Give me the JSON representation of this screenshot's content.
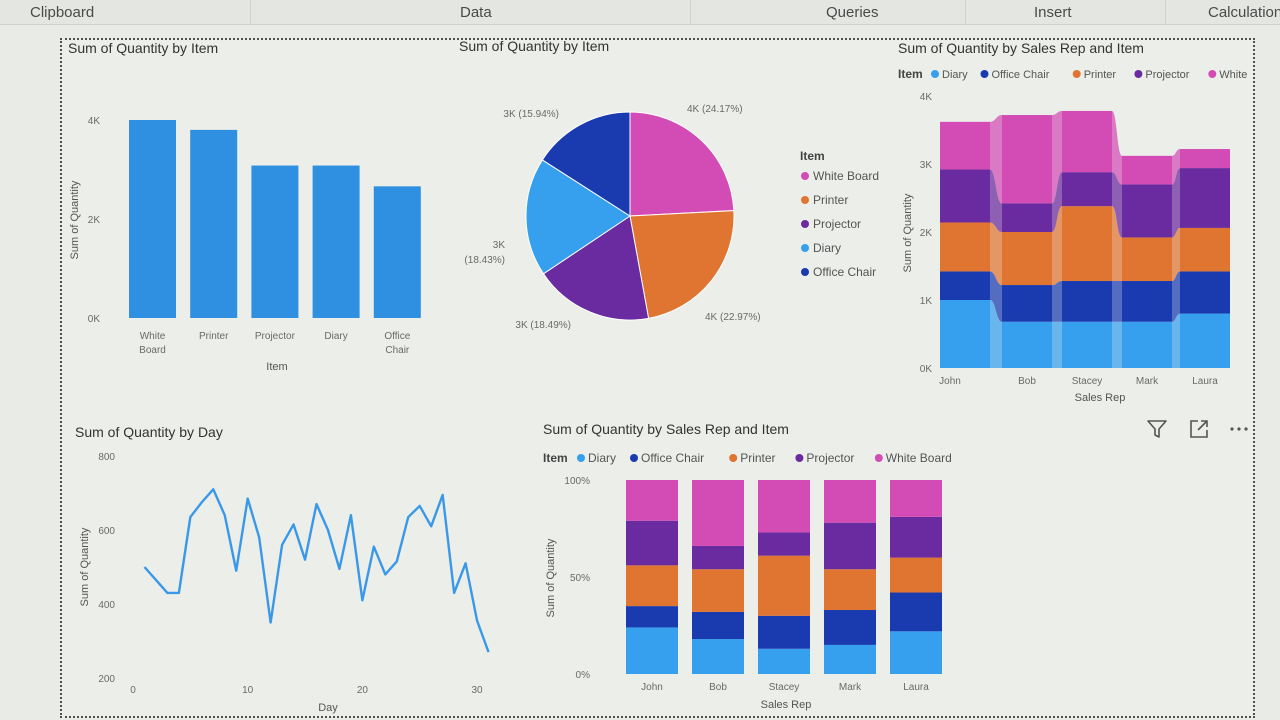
{
  "ribbon": {
    "items": [
      "Clipboard",
      "Data",
      "Queries",
      "Insert",
      "Calculation"
    ]
  },
  "colors": {
    "bar_blue": "#2f8fe0",
    "white_board": "#d34cb5",
    "printer": "#e07532",
    "projector": "#6a2aa0",
    "diary": "#36a0ee",
    "office_chair": "#1a3bb0",
    "line": "#3a98e8"
  },
  "visual_icons": [
    "filter-icon",
    "focus-mode-icon",
    "more-options-icon"
  ],
  "chart_data": [
    {
      "id": "bar",
      "type": "bar",
      "title": "Sum of Quantity by Item",
      "xlabel": "Item",
      "ylabel": "Sum of Quantity",
      "categories": [
        "White Board",
        "Printer",
        "Projector",
        "Diary",
        "Office Chair"
      ],
      "category_lines": [
        [
          "White",
          "Board"
        ],
        [
          "Printer"
        ],
        [
          "Projector"
        ],
        [
          "Diary"
        ],
        [
          "Office",
          "Chair"
        ]
      ],
      "values": [
        4000,
        3800,
        3080,
        3080,
        2660
      ],
      "ylim": [
        0,
        4000
      ],
      "yticks": [
        0,
        2000,
        4000
      ],
      "ytick_labels": [
        "0K",
        "2K",
        "4K"
      ]
    },
    {
      "id": "pie",
      "type": "pie",
      "title": "Sum of Quantity by Item",
      "legend_title": "Item",
      "labels": [
        "White Board",
        "Printer",
        "Projector",
        "Diary",
        "Office Chair"
      ],
      "values": [
        24.17,
        22.97,
        18.49,
        18.43,
        15.94
      ],
      "data_labels": [
        "4K (24.17%)",
        "4K (22.97%)",
        "3K (18.49%)",
        "3K (18.43%)",
        "3K (15.94%)"
      ]
    },
    {
      "id": "ribbon",
      "type": "area",
      "title": "Sum of Quantity by Sales Rep and Item",
      "xlabel": "Sales Rep",
      "ylabel": "Sum of Quantity",
      "legend_title": "Item",
      "legend": [
        "Diary",
        "Office Chair",
        "Printer",
        "Projector",
        "White Bo..."
      ],
      "categories": [
        "John",
        "Bob",
        "Stacey",
        "Mark",
        "Laura"
      ],
      "ylim": [
        0,
        4000
      ],
      "yticks": [
        0,
        1000,
        2000,
        3000,
        4000
      ],
      "ytick_labels": [
        "0K",
        "1K",
        "2K",
        "3K",
        "4K"
      ],
      "series": [
        {
          "name": "Diary",
          "values": [
            1000,
            680,
            680,
            680,
            800
          ]
        },
        {
          "name": "Office Chair",
          "values": [
            420,
            540,
            600,
            600,
            620
          ]
        },
        {
          "name": "Printer",
          "values": [
            720,
            780,
            1100,
            640,
            640
          ]
        },
        {
          "name": "Projector",
          "values": [
            780,
            420,
            500,
            780,
            880
          ]
        },
        {
          "name": "White Board",
          "values": [
            700,
            1300,
            900,
            420,
            280
          ]
        }
      ]
    },
    {
      "id": "line",
      "type": "line",
      "title": "Sum of Quantity by Day",
      "xlabel": "Day",
      "ylabel": "Sum of Quantity",
      "x": [
        1,
        2,
        3,
        4,
        5,
        6,
        7,
        8,
        9,
        10,
        11,
        12,
        13,
        14,
        15,
        16,
        17,
        18,
        19,
        20,
        21,
        22,
        23,
        24,
        25,
        26,
        27,
        28,
        29,
        30,
        31
      ],
      "y": [
        500,
        465,
        430,
        430,
        635,
        675,
        710,
        640,
        490,
        685,
        580,
        350,
        560,
        615,
        520,
        670,
        600,
        495,
        640,
        410,
        555,
        480,
        515,
        635,
        665,
        610,
        695,
        430,
        510,
        355,
        270
      ],
      "xlim": [
        0,
        32
      ],
      "ylim": [
        200,
        800
      ],
      "xticks": [
        0,
        10,
        20,
        30
      ],
      "yticks": [
        200,
        400,
        600,
        800
      ]
    },
    {
      "id": "stacked",
      "type": "bar",
      "title": "Sum of Quantity by Sales Rep and Item",
      "xlabel": "Sales Rep",
      "ylabel": "Sum of Quantity",
      "legend_title": "Item",
      "legend": [
        "Diary",
        "Office Chair",
        "Printer",
        "Projector",
        "White Board"
      ],
      "categories": [
        "John",
        "Bob",
        "Stacey",
        "Mark",
        "Laura"
      ],
      "yticks": [
        0,
        50,
        100
      ],
      "ytick_labels": [
        "0%",
        "50%",
        "100%"
      ],
      "series": [
        {
          "name": "Diary",
          "values": [
            24,
            18,
            13,
            15,
            22
          ]
        },
        {
          "name": "Office Chair",
          "values": [
            11,
            14,
            17,
            18,
            20
          ]
        },
        {
          "name": "Printer",
          "values": [
            21,
            22,
            31,
            21,
            18
          ]
        },
        {
          "name": "Projector",
          "values": [
            23,
            12,
            12,
            24,
            21
          ]
        },
        {
          "name": "White Board",
          "values": [
            21,
            34,
            27,
            22,
            19
          ]
        }
      ]
    }
  ]
}
